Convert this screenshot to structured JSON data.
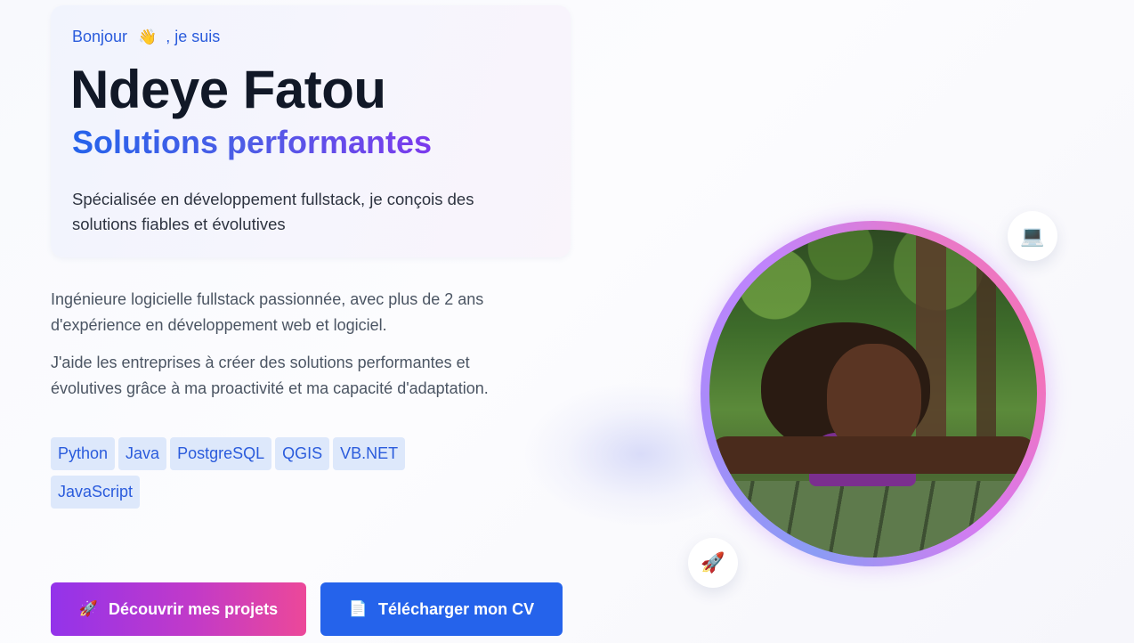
{
  "hero": {
    "greeting_prefix": "Bonjour",
    "greeting_emoji": "👋",
    "greeting_suffix": ", je suis",
    "name": "Ndeye Fatou",
    "tagline": "Solutions performantes",
    "intro_description": "Spécialisée en développement fullstack, je conçois des solutions fiables et évolutives"
  },
  "bio": {
    "paragraph_1": "Ingénieure logicielle fullstack passionnée, avec plus de 2 ans d'expérience en développement web et logiciel.",
    "paragraph_2": "J'aide les entreprises à créer des solutions performantes et évolutives grâce à ma proactivité et ma capacité d'adaptation."
  },
  "skills": [
    "Python",
    "Java",
    "PostgreSQL",
    "QGIS",
    "VB.NET",
    "JavaScript"
  ],
  "actions": {
    "projects": {
      "icon": "🚀",
      "label": "Découvrir mes projets"
    },
    "cv": {
      "icon": "📄",
      "label": "Télécharger mon CV"
    }
  },
  "floating_icons": {
    "laptop": "💻",
    "rocket": "🚀"
  },
  "colors": {
    "accent_blue": "#2563eb",
    "accent_purple": "#9333ea",
    "accent_pink": "#ec4899",
    "skill_bg": "#dde8fb"
  }
}
